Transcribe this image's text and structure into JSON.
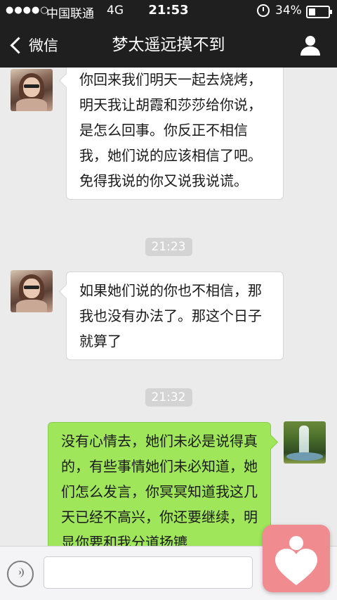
{
  "status_bar": {
    "signal": "●●●●○",
    "carrier": "中国联通",
    "network": "4G",
    "time": "21:53",
    "battery": "34%",
    "battery_level": 0.34
  },
  "nav": {
    "back_label": "微信",
    "title": "梦太遥远摸不到"
  },
  "messages": [
    {
      "type": "text",
      "side": "left",
      "text": "你回来我们明天一起去烧烤，明天我让胡霞和莎莎给你说，是怎么回事。你反正不相信我，她们说的应该相信了吧。免得我说的你又说我说谎。"
    },
    {
      "type": "time",
      "text": "21:23"
    },
    {
      "type": "text",
      "side": "left",
      "text": "如果她们说的你也不相信，那我也没有办法了。那这个日子就算了"
    },
    {
      "type": "time",
      "text": "21:32"
    },
    {
      "type": "text",
      "side": "right",
      "text": "没有心情去，她们未必是说得真的，有些事情她们未必知道，她们怎么发言，你冥冥知道我这几天已经不高兴，你还要继续，明显你要和我分道扬镳"
    }
  ],
  "input": {
    "placeholder": "",
    "value": ""
  },
  "colors": {
    "nav_bg": "#1f1f1f",
    "bubble_out": "#9fe65a",
    "bubble_in": "#ffffff",
    "chat_bg": "#ebebeb",
    "floating_button": "#f08c8f"
  }
}
